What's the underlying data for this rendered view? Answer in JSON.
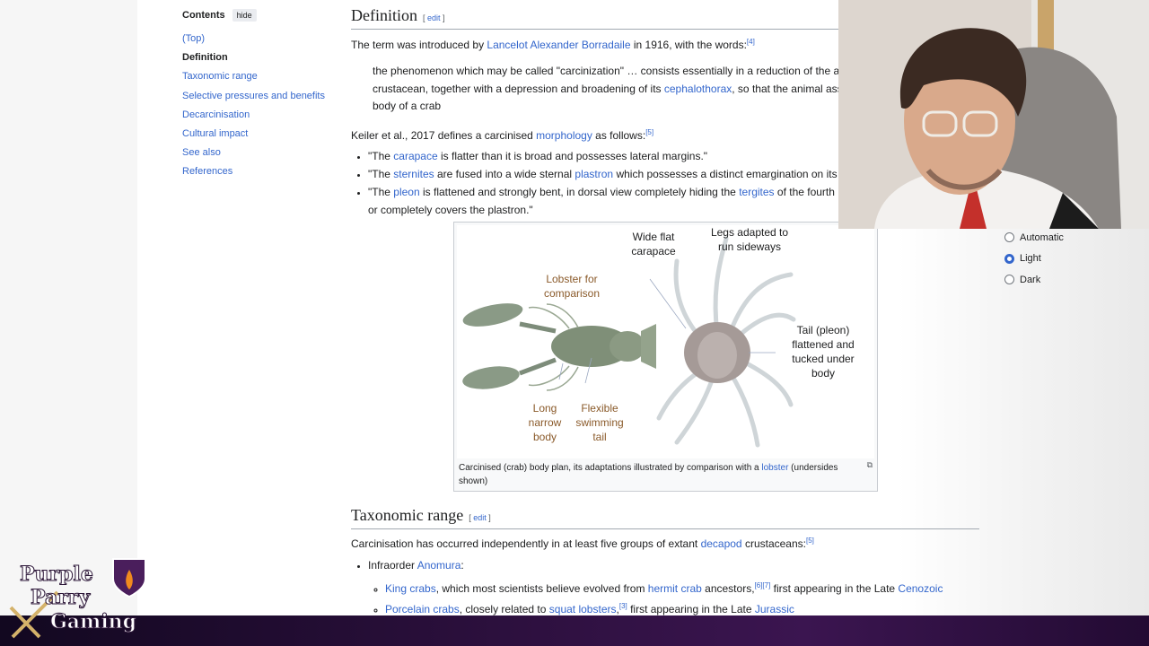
{
  "toc": {
    "title": "Contents",
    "hide_label": "hide",
    "items": [
      "(Top)",
      "Definition",
      "Taxonomic range",
      "Selective pressures and benefits",
      "Decarcinisation",
      "Cultural impact",
      "See also",
      "References"
    ]
  },
  "sections": {
    "definition": {
      "heading": "Definition",
      "edit_label": "edit"
    },
    "taxonomic": {
      "heading": "Taxonomic range",
      "edit_label": "edit"
    }
  },
  "definition": {
    "intro_pre": "The term was introduced by ",
    "intro_link": "Lancelot Alexander Borradaile",
    "intro_post": " in 1916, with the words:",
    "intro_ref": "[4]",
    "quote_l1": "the phenomenon which may be called \"carcinization\" … consists essentially in a reduction of the ab",
    "quote_l2_pre": "crustacean, together with a depression and broadening of its ",
    "quote_l2_link": "cephalothorax",
    "quote_l2_post": ", so that the animal assu",
    "quote_l3": "body of a crab",
    "keiler_pre": "Keiler et al., 2017 defines a carcinised ",
    "keiler_link": "morphology",
    "keiler_post": " as follows:",
    "keiler_ref": "[5]",
    "b1_pre": "\"The ",
    "b1_link": "carapace",
    "b1_post": " is flatter than it is broad and possesses lateral margins.\"",
    "b2_pre": "\"The ",
    "b2_link": "sternites",
    "b2_mid": " are fused into a wide sternal ",
    "b2_link2": "plastron",
    "b2_post": " which possesses a distinct emargination on its p",
    "b3_pre": "\"The ",
    "b3_link": "pleon",
    "b3_mid": " is flattened and strongly bent, in dorsal view completely hiding the ",
    "b3_link2": "tergites",
    "b3_post": " of the fourth pl",
    "b3_l2": "or completely covers the plastron.\""
  },
  "figure": {
    "label_lobster": "Lobster for comparison",
    "label_long": "Long narrow body",
    "label_flexible": "Flexible swimming tail",
    "label_wide": "Wide flat carapace",
    "label_legs": "Legs adapted to run sideways",
    "label_tail": "Tail (pleon) flattened and tucked under body",
    "caption_pre": "Carcinised (crab) body plan, its adaptations illustrated by comparison with a ",
    "caption_link": "lobster",
    "caption_post": " (undersides shown)"
  },
  "taxonomic": {
    "intro_pre": "Carcinisation has occurred independently in at least five groups of extant ",
    "intro_link": "decapod",
    "intro_post": " crustaceans:",
    "intro_ref": "[5]",
    "infraorder_pre": "Infraorder ",
    "infraorder_link": "Anomura",
    "infraorder_post": ":",
    "king_link": "King crabs",
    "king_mid": ", which most scientists believe evolved from ",
    "king_link2": "hermit crab",
    "king_post": " ancestors,",
    "king_refs": "[6][7]",
    "king_tail": " first appearing in the Late ",
    "king_link3": "Cenozoic",
    "porc_link": "Porcelain crabs",
    "porc_mid": ", closely related to ",
    "porc_link2": "squat lobsters",
    "porc_ref": "[3]",
    "porc_tail": " first appearing in the Late ",
    "porc_link3": "Jurassic"
  },
  "appearance": {
    "options": [
      "Automatic",
      "Light",
      "Dark"
    ],
    "selected": "Light"
  },
  "overlay": {
    "logo_line1": "Purple",
    "logo_line2": "Parry",
    "logo_line3": "Gaming"
  },
  "colors": {
    "link": "#3366cc",
    "bar": "#2a0f3b",
    "logo_purple": "#6b2a8a"
  }
}
